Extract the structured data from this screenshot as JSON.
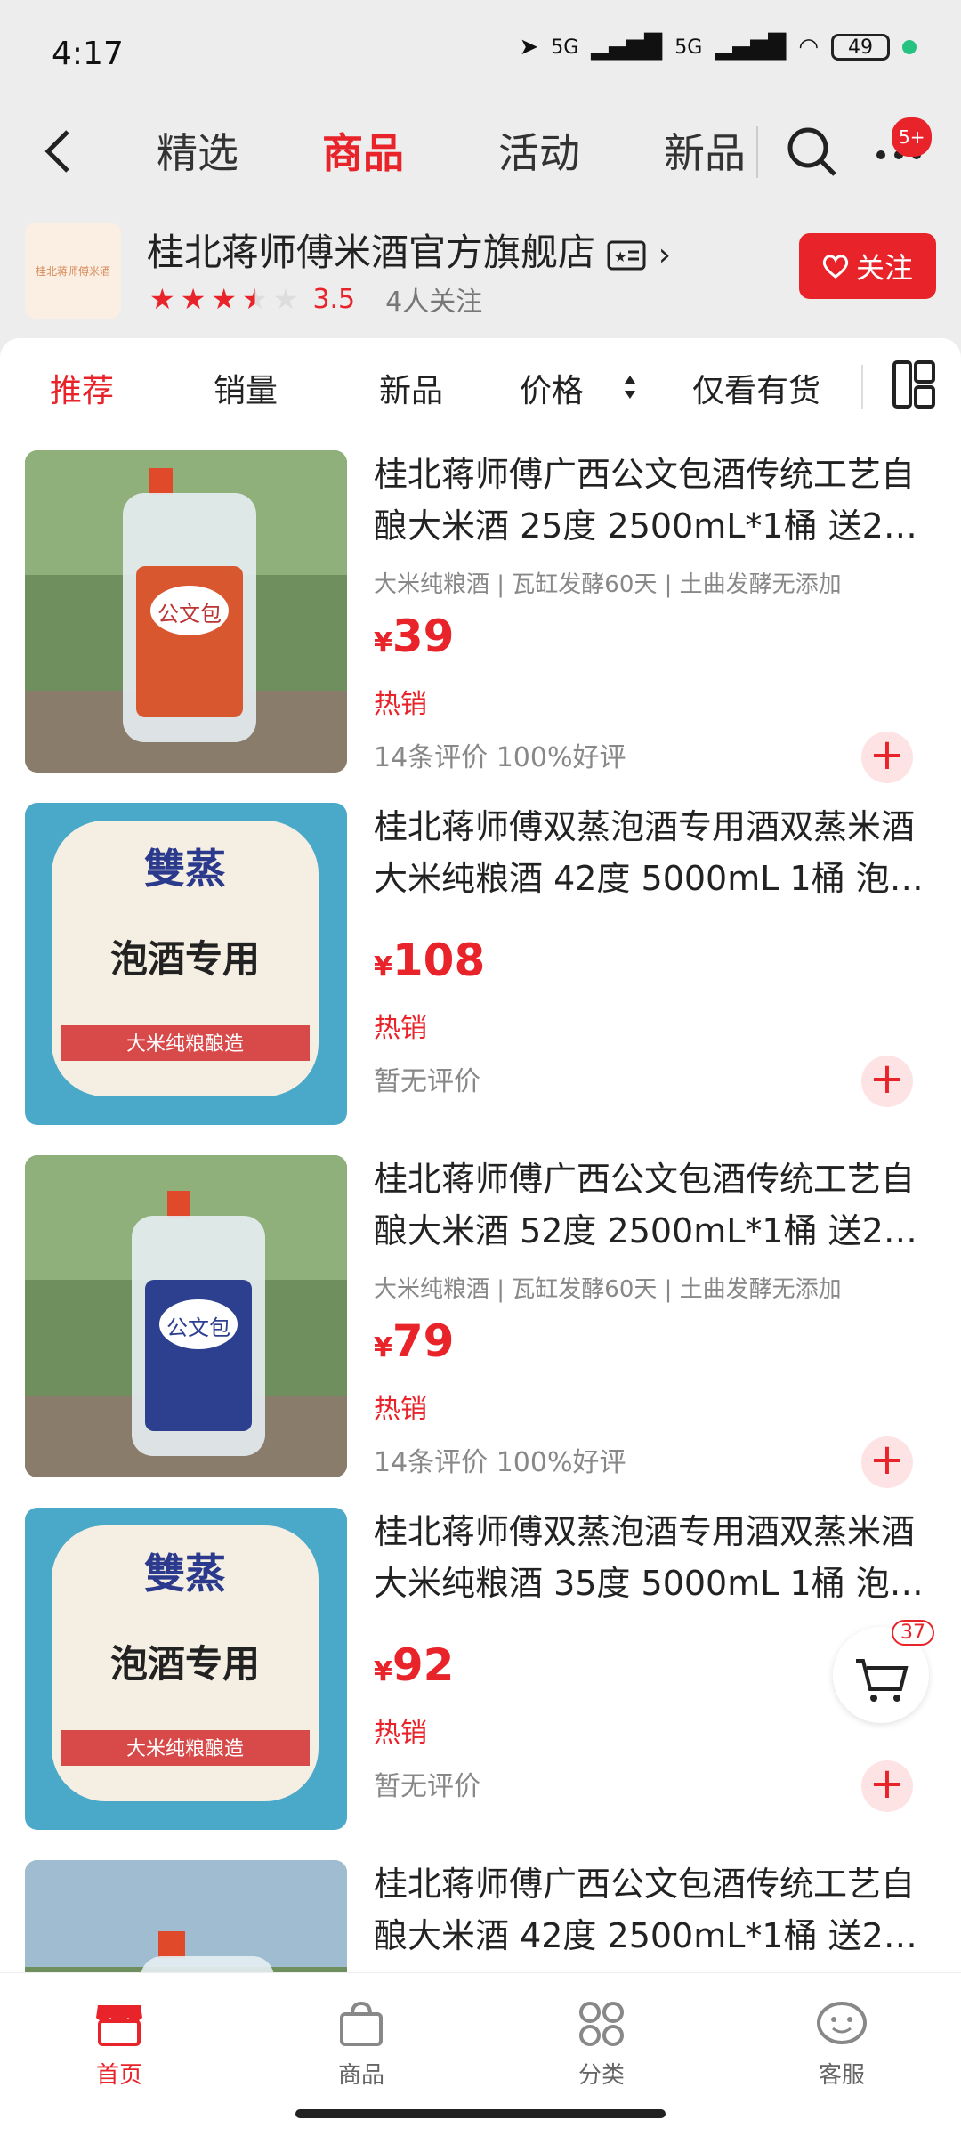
{
  "status": {
    "time": "4:17",
    "network": "5G",
    "network2": "5G",
    "battery": "49"
  },
  "nav": {
    "tabs": [
      "精选",
      "商品",
      "活动",
      "新品"
    ],
    "active_tab": 1,
    "more_badge": "5+"
  },
  "shop": {
    "name": "桂北蒋师傅米酒官方旗舰店",
    "rating": "3.5",
    "followers": "4人关注",
    "follow_label": "关注",
    "logo_text": "桂北蒋师傅米酒"
  },
  "sort": {
    "items": [
      "推荐",
      "销量",
      "新品",
      "价格",
      "仅看有货"
    ],
    "active": 0
  },
  "products": [
    {
      "title": "桂北蒋师傅广西公文包酒传统工艺自酿大米酒 25度 2500mL*1桶 送2…",
      "tags": "大米纯粮酒 | 瓦缸发酵60天 | 土曲发酵无添加",
      "yen": "¥",
      "price": "39",
      "hot": "热销",
      "reviews": "14条评价  100%好评",
      "img": "bottle-red"
    },
    {
      "title": "桂北蒋师傅双蒸泡酒专用酒双蒸米酒大米纯粮酒 42度 5000mL 1桶 泡…",
      "tags": "",
      "yen": "¥",
      "price": "108",
      "hot": "热销",
      "reviews": "暂无评价",
      "img": "label-blue"
    },
    {
      "title": "桂北蒋师傅广西公文包酒传统工艺自酿大米酒 52度 2500mL*1桶 送2…",
      "tags": "大米纯粮酒 | 瓦缸发酵60天 | 土曲发酵无添加",
      "yen": "¥",
      "price": "79",
      "hot": "热销",
      "reviews": "14条评价  100%好评",
      "img": "bottle-blue"
    },
    {
      "title": "桂北蒋师傅双蒸泡酒专用酒双蒸米酒大米纯粮酒 35度 5000mL 1桶 泡…",
      "tags": "",
      "yen": "¥",
      "price": "92",
      "hot": "热销",
      "reviews": "暂无评价",
      "img": "label-blue"
    },
    {
      "title": "桂北蒋师傅广西公文包酒传统工艺自酿大米酒 42度 2500mL*1桶 送2…",
      "tags": "",
      "yen": "",
      "price": "",
      "hot": "",
      "reviews": "",
      "img": "bottle-partial"
    }
  ],
  "product_labels": {
    "gongwenbao": "公文包",
    "shuangzheng": "雙蒸",
    "paojiu": "泡酒专用",
    "ribbon": "大米纯粮酿造"
  },
  "cart": {
    "count": "37"
  },
  "bottom_nav": [
    "首页",
    "商品",
    "分类",
    "客服"
  ],
  "colors": {
    "accent": "#e8232a",
    "label_blue": "#4aa9c9",
    "bottle_red": "#d9572f",
    "bottle_navy": "#2d3f8f"
  }
}
